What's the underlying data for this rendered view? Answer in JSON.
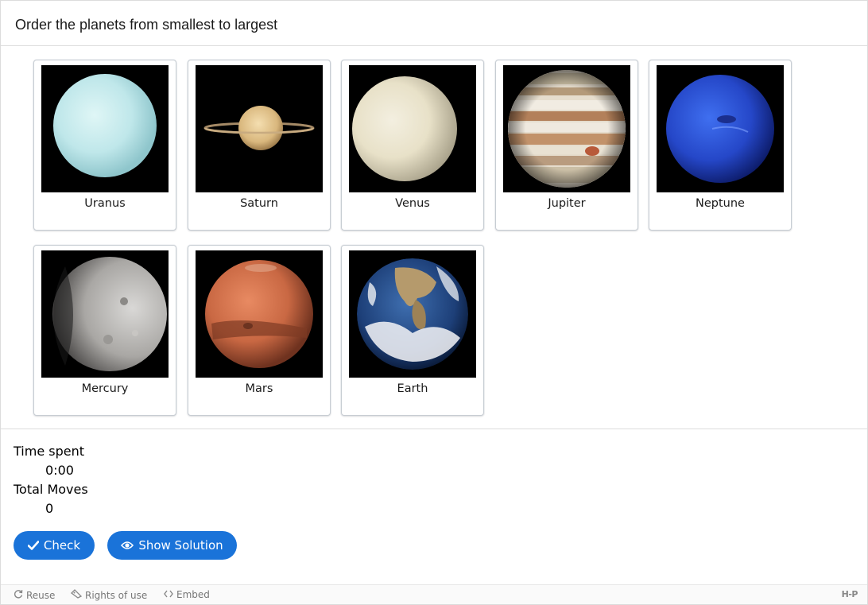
{
  "task": {
    "title": "Order the planets from smallest to largest"
  },
  "cards": [
    {
      "label": "Uranus",
      "icon": "uranus-image"
    },
    {
      "label": "Saturn",
      "icon": "saturn-image"
    },
    {
      "label": "Venus",
      "icon": "venus-image"
    },
    {
      "label": "Jupiter",
      "icon": "jupiter-image"
    },
    {
      "label": "Neptune",
      "icon": "neptune-image"
    },
    {
      "label": "Mercury",
      "icon": "mercury-image"
    },
    {
      "label": "Mars",
      "icon": "mars-image"
    },
    {
      "label": "Earth",
      "icon": "earth-image"
    }
  ],
  "stats": {
    "time_label": "Time spent",
    "time_value": "0:00",
    "moves_label": "Total Moves",
    "moves_value": "0"
  },
  "buttons": {
    "check_label": "Check",
    "solution_label": "Show Solution"
  },
  "footer": {
    "reuse_label": "Reuse",
    "rights_label": "Rights of use",
    "embed_label": "Embed",
    "logo_text": "H-P"
  },
  "colors": {
    "button_blue": "#1a73d9",
    "card_border": "#c7cdd3",
    "divider": "#dddddd"
  }
}
